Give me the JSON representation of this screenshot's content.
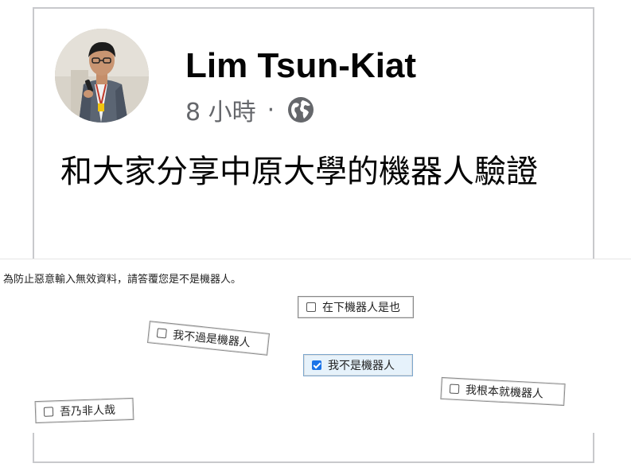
{
  "post": {
    "author": "Lim Tsun-Kiat",
    "time": "8 小時",
    "separator": "·",
    "visibility_icon": "globe-icon",
    "text": "和大家分享中原大學的機器人驗證"
  },
  "captcha": {
    "prompt": "為防止惡意輸入無效資料，請答覆您是不是機器人。",
    "options": [
      {
        "label": "在下機器人是也",
        "checked": false
      },
      {
        "label": "我不過是機器人",
        "checked": false
      },
      {
        "label": "我不是機器人",
        "checked": true
      },
      {
        "label": "我根本就機器人",
        "checked": false
      },
      {
        "label": "吾乃非人哉",
        "checked": false
      }
    ],
    "accent_color": "#1a73e8"
  }
}
